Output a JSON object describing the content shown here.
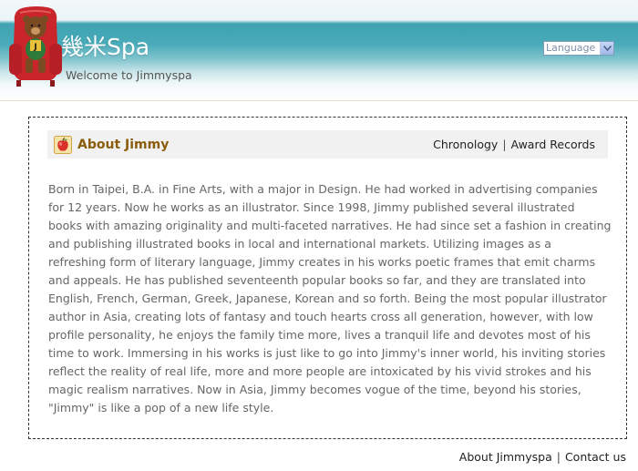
{
  "header": {
    "site_title": "幾米Spa",
    "welcome": "Welcome to Jimmyspa",
    "language_label": "Language"
  },
  "section": {
    "title": "About Jimmy",
    "links": [
      "Chronology",
      "Award Records"
    ],
    "separator": "|"
  },
  "bio": "Born in Taipei, B.A. in Fine Arts, with a major in Design. He had worked in advertising companies for 12 years. Now he works as an illustrator. Since 1998, Jimmy published several illustrated books with amazing originality and multi-faceted narratives. He had since set a fashion in creating and publishing illustrated books in local and international markets. Utilizing images as a refreshing form of literary language, Jimmy creates in his works poetic frames that emit charms and appeals. He has published seventeenth popular books so far, and they are translated into English, French, German, Greek, Japanese, Korean and so forth. Being the most popular illustrator author in Asia, creating lots of fantasy and touch hearts cross all generation, however, with low profile personality, he enjoys the family time more, lives a tranquil life and devotes most of his time to work. Immersing in his works is just like to go into Jimmy's inner world, his inviting stories reflect the reality of real life, more and more people are intoxicated by his vivid strokes and his magic realism narratives. Now in Asia, Jimmy becomes vogue of the time, beyond his stories, \"Jimmy\" is like a pop of a new life style.",
  "footer": {
    "links": [
      "About Jimmyspa",
      "Contact us"
    ],
    "separator": "|"
  },
  "colors": {
    "header_teal": "#49aab8",
    "section_title": "#8a5c0b",
    "body_text": "#666666",
    "section_head_bg": "#f1f1f1"
  },
  "icons": {
    "logo": "bear-on-red-armchair-logo",
    "section": "apple-icon",
    "language": "chevron-down-icon"
  }
}
